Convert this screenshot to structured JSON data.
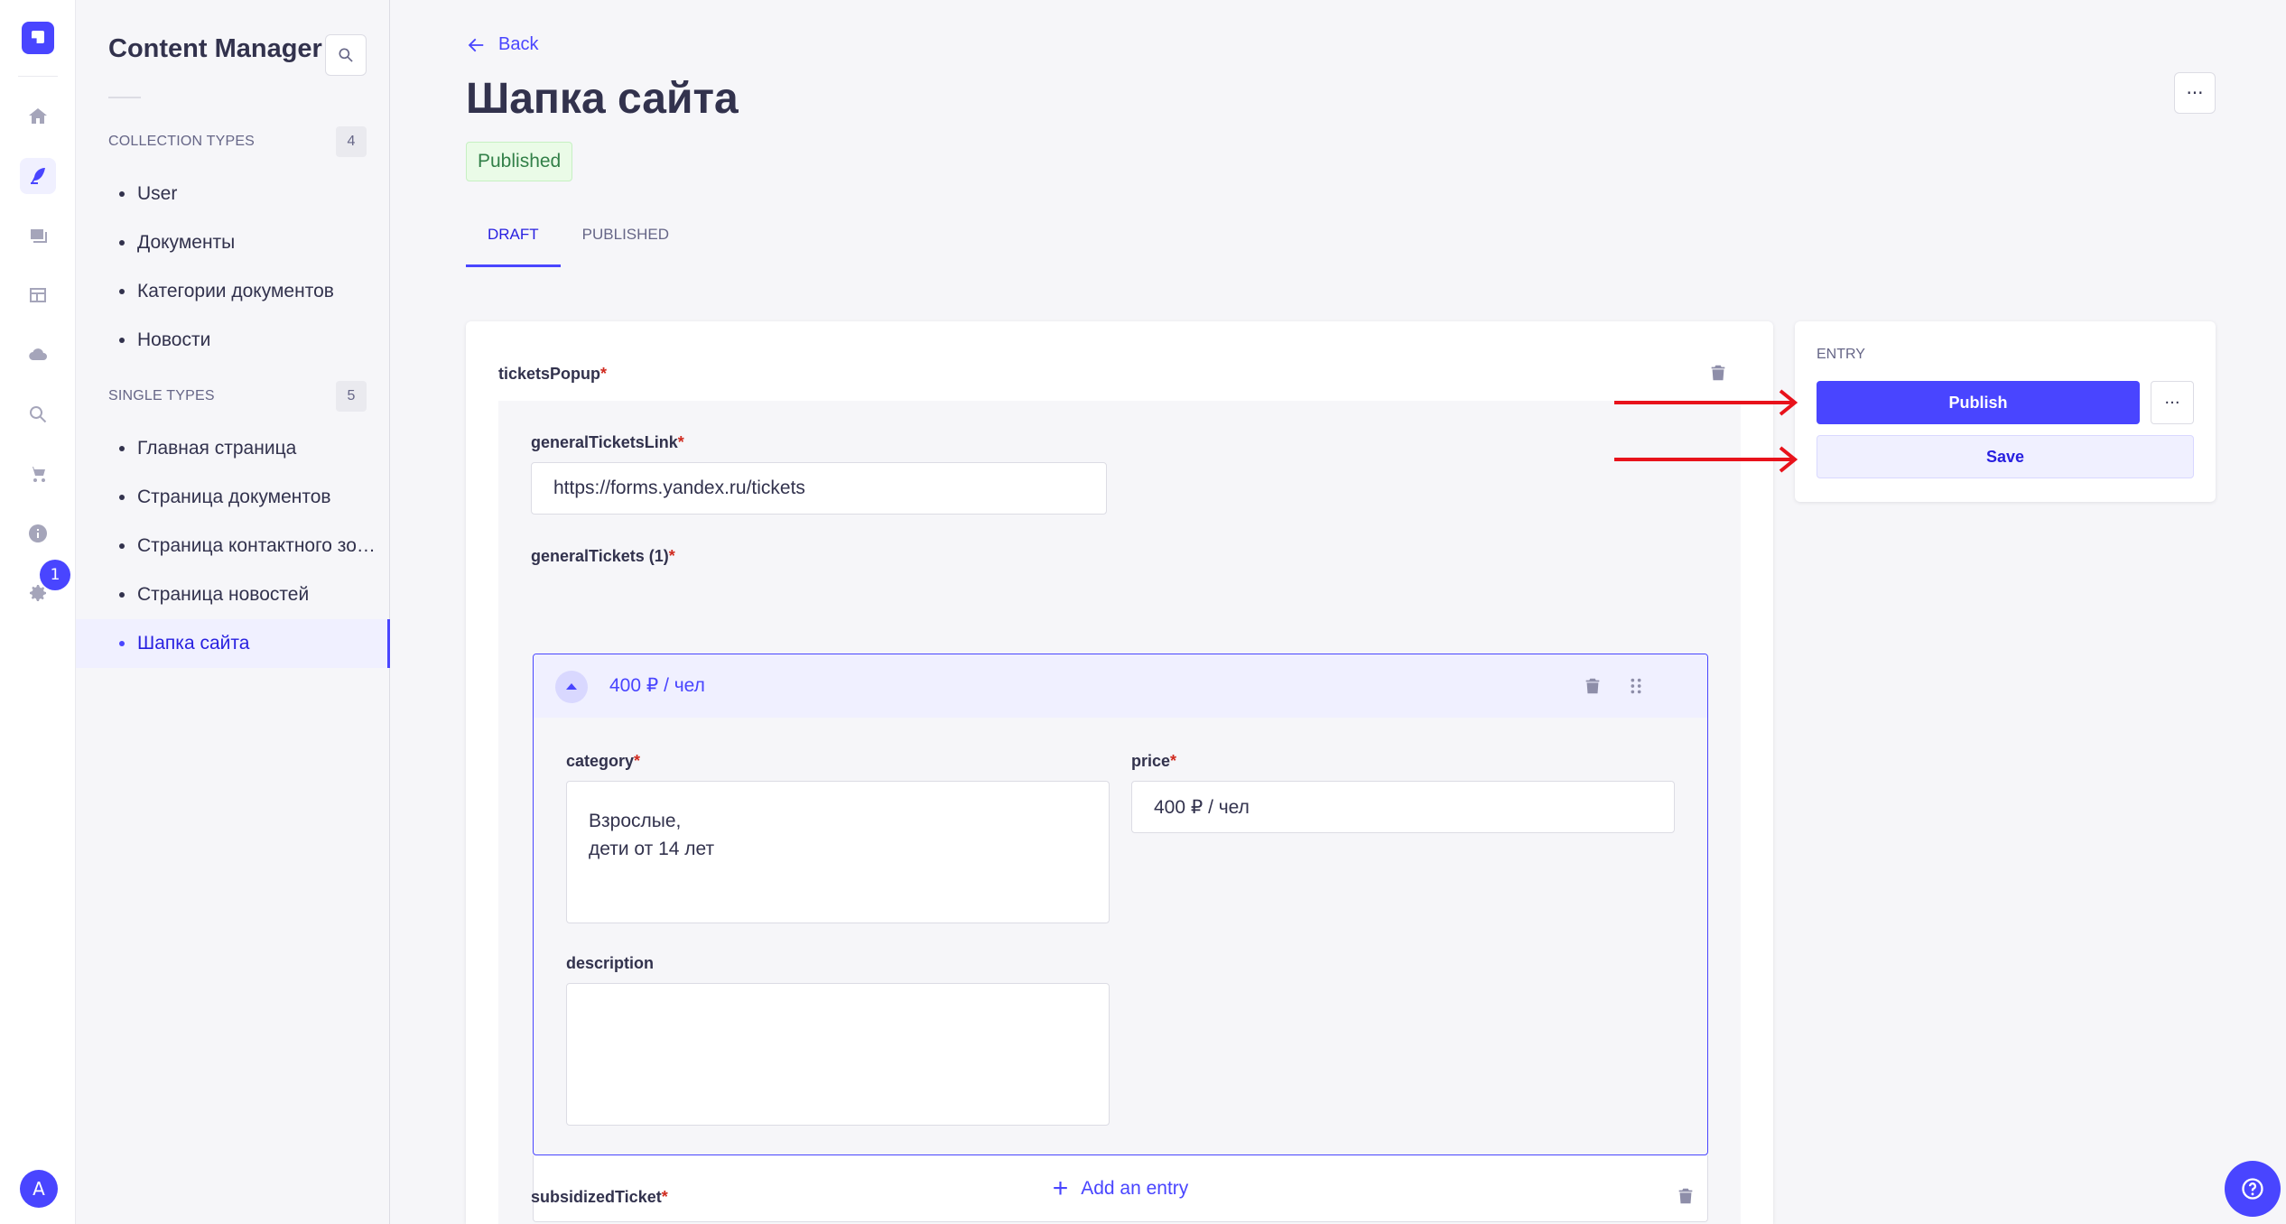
{
  "rail": {
    "settings_badge": "1",
    "avatar_initial": "A",
    "items": [
      "home-icon",
      "content-manager-icon",
      "media-library-icon",
      "content-type-builder-icon",
      "cloud-icon",
      "search-icon",
      "cart-icon",
      "info-icon",
      "settings-icon"
    ]
  },
  "subnav": {
    "title": "Content Manager",
    "collection_types": {
      "heading": "COLLECTION TYPES",
      "count": "4",
      "items": [
        "User",
        "Документы",
        "Категории документов",
        "Новости"
      ]
    },
    "single_types": {
      "heading": "SINGLE TYPES",
      "count": "5",
      "items": [
        "Главная страница",
        "Страница документов",
        "Страница контактного зоопарка",
        "Страница новостей",
        "Шапка сайта"
      ],
      "active": "Шапка сайта"
    }
  },
  "header": {
    "back_label": "Back",
    "title": "Шапка сайта",
    "status": "Published",
    "more_label": "···",
    "tabs": [
      {
        "label": "DRAFT",
        "active": true
      },
      {
        "label": "PUBLISHED",
        "active": false
      }
    ]
  },
  "form": {
    "tickets_popup_label": "ticketsPopup",
    "general_tickets_link_label": "generalTicketsLink",
    "general_tickets_link_value": "https://forms.yandex.ru/tickets",
    "general_tickets_label": "generalTickets (1)",
    "entry_title": "400 ₽ / чел",
    "category_label": "category",
    "category_value": "Взрослые,\nдети от 14 лет",
    "price_label": "price",
    "price_value": "400  ₽ / чел",
    "description_label": "description",
    "description_value": "",
    "add_entry_label": "Add an entry",
    "subsidized_ticket_label": "subsidizedTicket",
    "required_mark": "*"
  },
  "panel": {
    "title": "ENTRY",
    "publish_label": "Publish",
    "save_label": "Save",
    "more_label": "···"
  },
  "colors": {
    "primary": "#4945ff",
    "status_bg": "#eafbe7",
    "status_text": "#328048",
    "required": "#d02b20",
    "annotation_arrow": "#e8121b"
  }
}
